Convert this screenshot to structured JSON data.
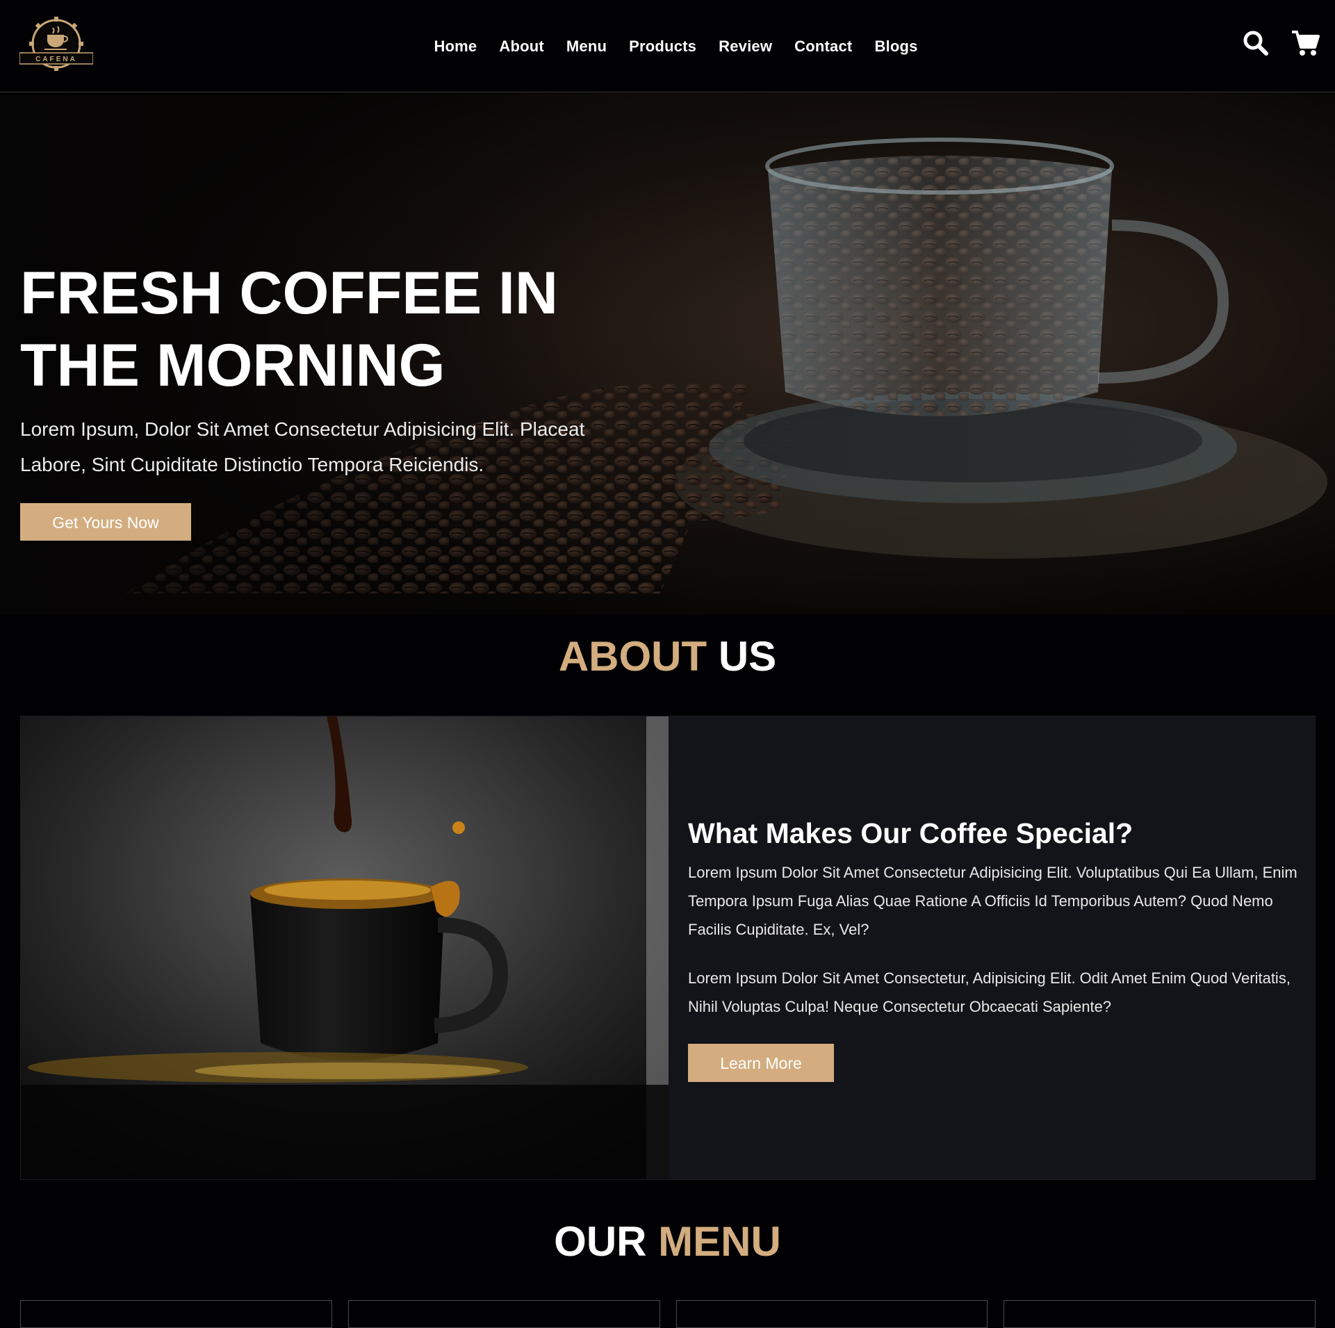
{
  "brand": {
    "logo_text": "CAFENA",
    "accent_color": "#d3ad7f",
    "background": "#010103"
  },
  "nav": {
    "links": [
      "Home",
      "About",
      "Menu",
      "Products",
      "Review",
      "Contact",
      "Blogs"
    ],
    "icons": [
      "search-icon",
      "shopping-cart-icon"
    ]
  },
  "hero": {
    "title": "FRESH COFFEE IN THE MORNING",
    "text": "Lorem Ipsum, Dolor Sit Amet Consectetur Adipisicing Elit. Placeat Labore, Sint Cupiditate Distinctio Tempora Reiciendis.",
    "button_label": "Get Yours Now"
  },
  "about": {
    "heading_accent": "ABOUT",
    "heading_rest": "US",
    "title": "What Makes Our Coffee Special?",
    "paragraph_1": "Lorem Ipsum Dolor Sit Amet Consectetur Adipisicing Elit. Voluptatibus Qui Ea Ullam, Enim Tempora Ipsum Fuga Alias Quae Ratione A Officiis Id Temporibus Autem? Quod Nemo Facilis Cupiditate. Ex, Vel?",
    "paragraph_2": "Lorem Ipsum Dolor Sit Amet Consectetur, Adipisicing Elit. Odit Amet Enim Quod Veritatis, Nihil Voluptas Culpa! Neque Consectetur Obcaecati Sapiente?",
    "button_label": "Learn More"
  },
  "menu": {
    "heading_rest": "OUR",
    "heading_accent": "MENU",
    "card_count": 4
  }
}
